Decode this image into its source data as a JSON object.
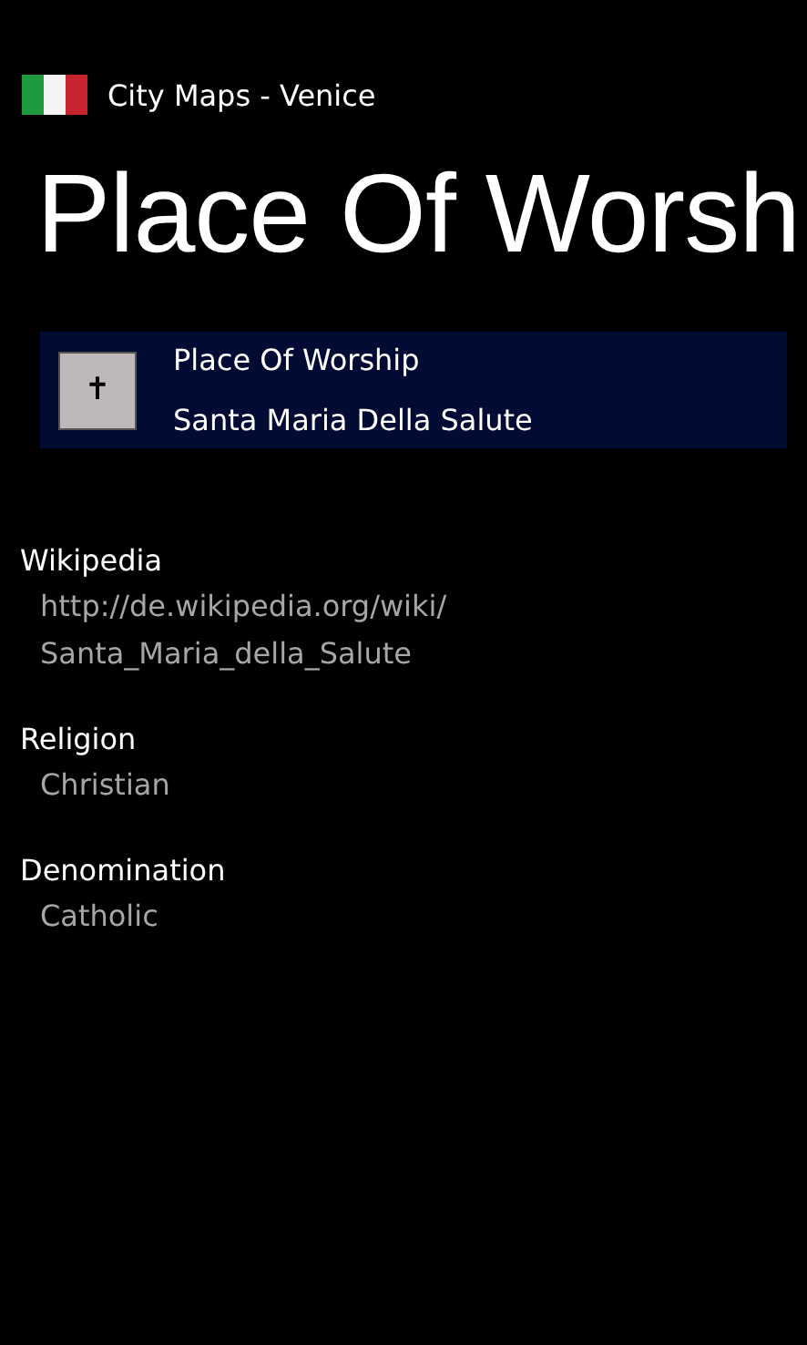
{
  "app": {
    "title": "City Maps - Venice"
  },
  "page_title": "Place Of Worsh",
  "place": {
    "category": "Place Of Worship",
    "name": "Santa Maria Della Salute",
    "icon": "✝"
  },
  "fields": [
    {
      "label": "Wikipedia",
      "value_lines": [
        "http://de.wikipedia.org/wiki/",
        "Santa_Maria_della_Salute"
      ]
    },
    {
      "label": "Religion",
      "value_lines": [
        "Christian"
      ]
    },
    {
      "label": "Denomination",
      "value_lines": [
        "Catholic"
      ]
    }
  ]
}
